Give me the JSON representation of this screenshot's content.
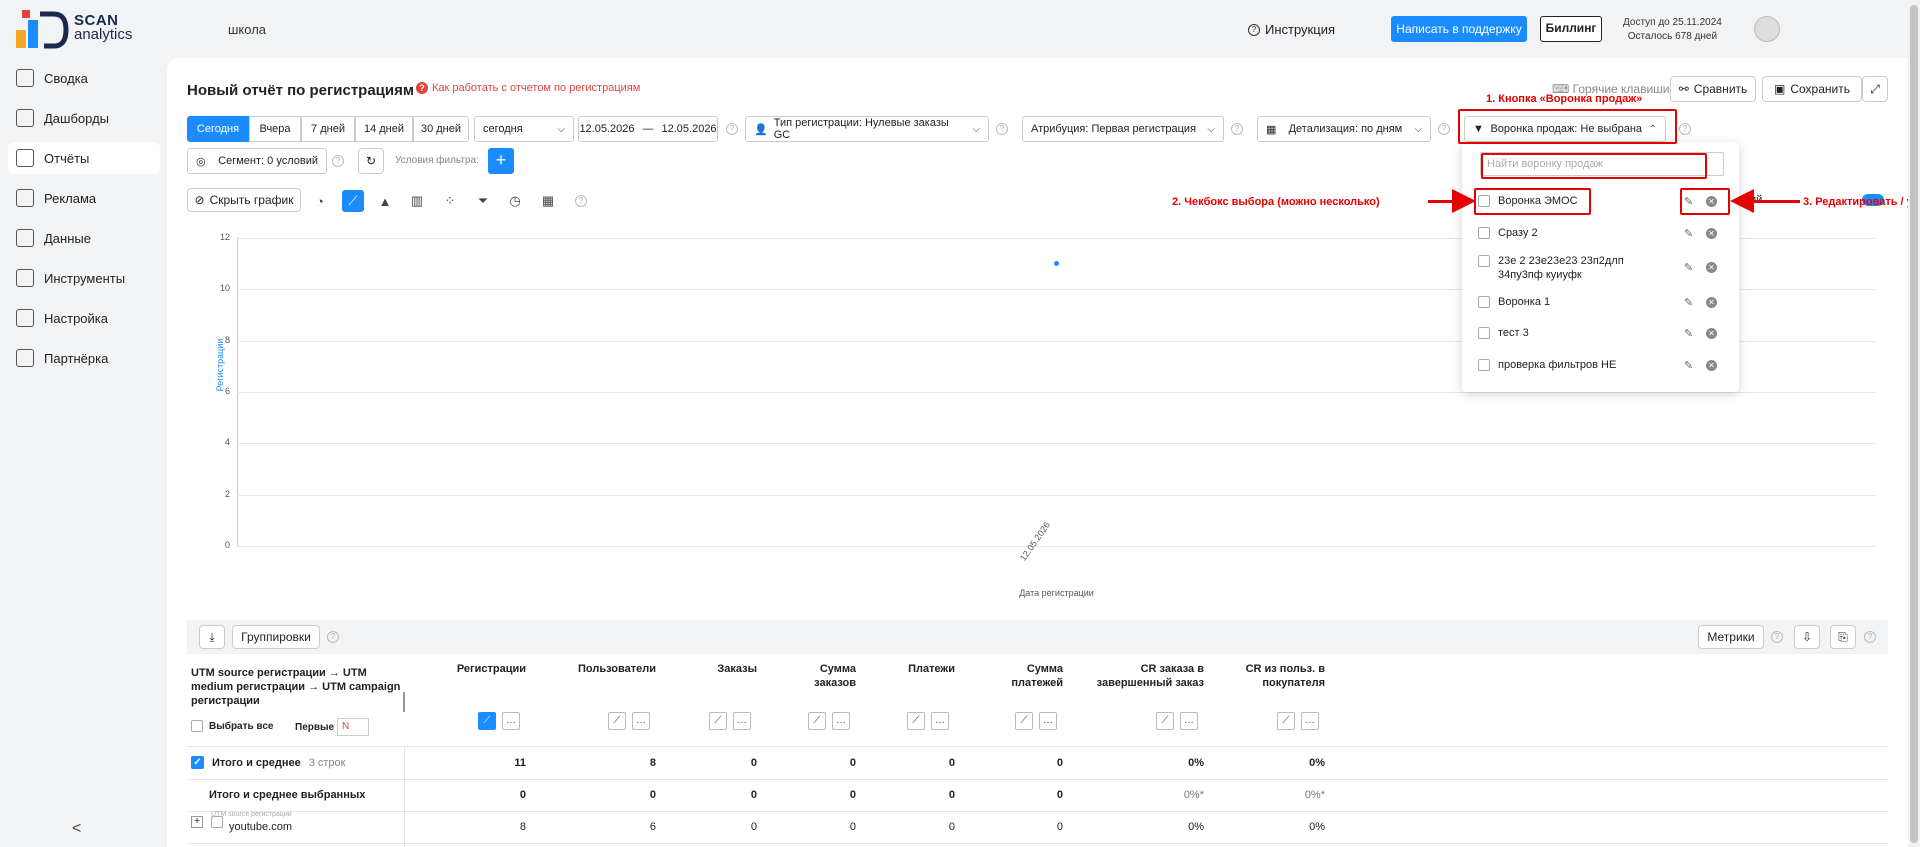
{
  "brand": {
    "line1": "SCAN",
    "line2": "analytics"
  },
  "header": {
    "project": "школа",
    "instruction": "Инструкция",
    "support": "Написать в поддержку",
    "billing": "Биллинг",
    "access_line1": "Доступ до 25.11.2024",
    "access_line2": "Осталось 678 дней"
  },
  "sidebar": {
    "items": [
      {
        "label": "Сводка",
        "icon": "summary-icon"
      },
      {
        "label": "Дашборды",
        "icon": "dashboards-icon"
      },
      {
        "label": "Отчёты",
        "icon": "reports-icon"
      },
      {
        "label": "Реклама",
        "icon": "ads-icon"
      },
      {
        "label": "Данные",
        "icon": "data-icon"
      },
      {
        "label": "Инструменты",
        "icon": "tools-icon"
      },
      {
        "label": "Настройка",
        "icon": "settings-icon"
      },
      {
        "label": "Партнёрка",
        "icon": "partners-icon"
      }
    ],
    "collapse": "<"
  },
  "report": {
    "title": "Новый отчёт по регистрациям",
    "howto": "Как работать с отчетом по регистрациям",
    "hotkeys": "Горячие клавиши",
    "compare": "Сравнить",
    "save": "Сохранить"
  },
  "periods": [
    "Сегодня",
    "Вчера",
    "7 дней",
    "14 дней",
    "30 дней"
  ],
  "period_select": "сегодня",
  "date_from": "12.05.2026",
  "date_sep": "—",
  "date_to": "12.05.2026",
  "filters": {
    "reg_type": "Тип регистрации: Нулевые заказы GC",
    "attribution": "Атрибуция: Первая регистрация",
    "detail": "Детализация:  по дням",
    "funnel": "Воронка продаж: Не выбрана",
    "segment": "Сегмент: 0 условий",
    "conditions": "Условия фильтра:"
  },
  "annotations": {
    "a1": "1. Кнопка «Воронка продаж»",
    "a2": "2. Чекбокс выбора (можно несколько)",
    "a3": "3. Редактировать / у"
  },
  "chart_toolbar": {
    "hide": "Скрыть график"
  },
  "funnel_dropdown": {
    "placeholder": "Найти воронку продаж",
    "items": [
      "Воронка ЭМОС",
      "Сразу 2",
      "23е 2 23е23е23 23п2длп 34пу3пф куиуфк",
      "Воронка 1",
      "тест 3",
      "проверка фильтров НЕ"
    ],
    "behind_text": "ий..."
  },
  "chart_data": {
    "type": "scatter",
    "title": "",
    "xlabel": "Дата регистрации",
    "ylabel": "Регистрации",
    "ylim": [
      0,
      12
    ],
    "yticks": [
      "12",
      "10",
      "8",
      "6",
      "4",
      "2",
      "0"
    ],
    "x": [
      "12.05.2026"
    ],
    "series": [
      {
        "values": [
          11
        ]
      }
    ],
    "grid": true
  },
  "table": {
    "toolbar": {
      "groupings": "Группировки",
      "metrics": "Метрики"
    },
    "dimension_header": "UTM source регистрации → UTM medium регистрации → UTM campaign регистрации",
    "select_all": "Выбрать все",
    "first": "Первые",
    "first_placeholder": "N",
    "columns": [
      "Регистрации",
      "Пользователи",
      "Заказы",
      "Сумма заказов",
      "Платежи",
      "Сумма платежей",
      "CR заказа в завершенный заказ",
      "CR из польз. в покупателя"
    ],
    "total_label": "Итого и среднее",
    "total_rows": "3 строк",
    "total_values": [
      "11",
      "8",
      "0",
      "0",
      "0",
      "0",
      "0%",
      "0%"
    ],
    "selected_label": "Итого и среднее выбранных",
    "selected_values": [
      "0",
      "0",
      "0",
      "0",
      "0",
      "0",
      "0%*",
      "0%*"
    ],
    "row_hint": "UTM source регистрации",
    "rows": [
      {
        "label": "youtube.com",
        "values": [
          "8",
          "6",
          "0",
          "0",
          "0",
          "0",
          "0%",
          "0%"
        ]
      }
    ]
  },
  "colors": {
    "accent": "#1a8cff",
    "annotation": "#e60000"
  }
}
